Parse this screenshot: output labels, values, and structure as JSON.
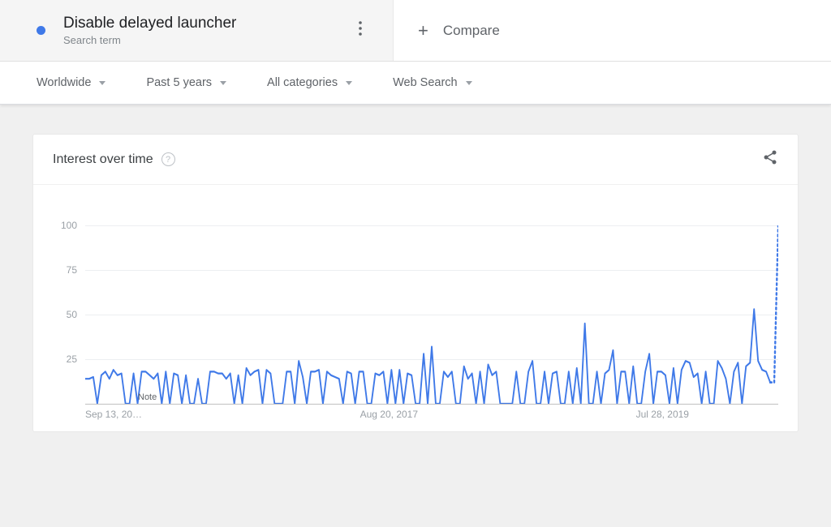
{
  "term": {
    "title": "Disable delayed launcher",
    "subtitle": "Search term"
  },
  "compare": {
    "label": "Compare"
  },
  "filters": {
    "region": "Worldwide",
    "time": "Past 5 years",
    "category": "All categories",
    "search_type": "Web Search"
  },
  "chart": {
    "title": "Interest over time",
    "note": "Note",
    "y_ticks": [
      "25",
      "50",
      "75",
      "100"
    ]
  },
  "chart_data": {
    "type": "line",
    "title": "Interest over time",
    "ylabel": "",
    "xlabel": "",
    "ylim": [
      0,
      100
    ],
    "x_ticks": [
      "Sep 13, 20…",
      "Aug 20, 2017",
      "Jul 28, 2019"
    ],
    "series": [
      {
        "name": "Disable delayed launcher",
        "color": "#3f79e8",
        "values": [
          14,
          14,
          15,
          0,
          16,
          18,
          14,
          19,
          16,
          17,
          0,
          0,
          17,
          0,
          18,
          18,
          16,
          14,
          17,
          0,
          18,
          0,
          17,
          16,
          0,
          16,
          0,
          0,
          14,
          0,
          0,
          18,
          18,
          17,
          17,
          14,
          17,
          0,
          16,
          0,
          20,
          16,
          18,
          19,
          0,
          19,
          17,
          0,
          0,
          0,
          18,
          18,
          0,
          24,
          15,
          0,
          18,
          18,
          19,
          0,
          18,
          16,
          15,
          14,
          0,
          18,
          17,
          0,
          18,
          18,
          0,
          0,
          17,
          16,
          18,
          0,
          19,
          0,
          19,
          0,
          17,
          16,
          0,
          0,
          28,
          0,
          32,
          0,
          0,
          18,
          15,
          18,
          0,
          0,
          21,
          14,
          17,
          0,
          18,
          0,
          22,
          16,
          18,
          0,
          0,
          0,
          0,
          18,
          0,
          0,
          18,
          24,
          0,
          0,
          18,
          0,
          17,
          18,
          0,
          0,
          18,
          0,
          20,
          0,
          45,
          0,
          0,
          18,
          0,
          17,
          19,
          30,
          0,
          18,
          18,
          0,
          21,
          0,
          0,
          18,
          28,
          0,
          18,
          18,
          16,
          0,
          20,
          0,
          19,
          24,
          23,
          15,
          17,
          0,
          18,
          0,
          0,
          24,
          20,
          14,
          0,
          18,
          23,
          0,
          21,
          23,
          53,
          24,
          19,
          18,
          12,
          12,
          100
        ]
      }
    ],
    "forecast_from_index": 170
  }
}
